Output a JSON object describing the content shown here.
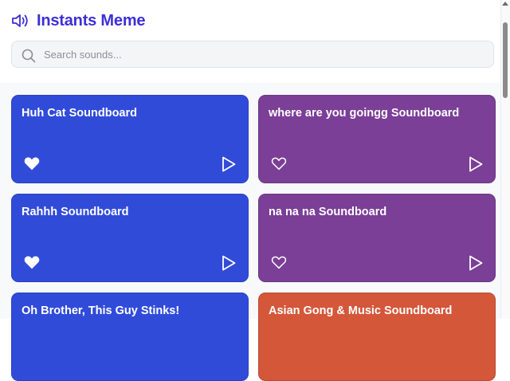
{
  "app": {
    "title": "Instants Meme",
    "icon": "speaker-icon",
    "accent_color": "#3d2fd6"
  },
  "search": {
    "placeholder": "Search sounds...",
    "value": ""
  },
  "cards": [
    {
      "title": "Huh Cat Soundboard",
      "color": "#314bd9",
      "favorited": true
    },
    {
      "title": "where are you goingg Soundboard",
      "color": "#7b3f97",
      "favorited": false
    },
    {
      "title": "Rahhh Soundboard",
      "color": "#314bd9",
      "favorited": true
    },
    {
      "title": "na na na Soundboard",
      "color": "#7b3f97",
      "favorited": false
    },
    {
      "title": "Oh Brother, This Guy Stinks!",
      "color": "#314bd9",
      "favorited": false
    },
    {
      "title": "Asian Gong & Music Soundboard",
      "color": "#d4573a",
      "favorited": false
    }
  ]
}
